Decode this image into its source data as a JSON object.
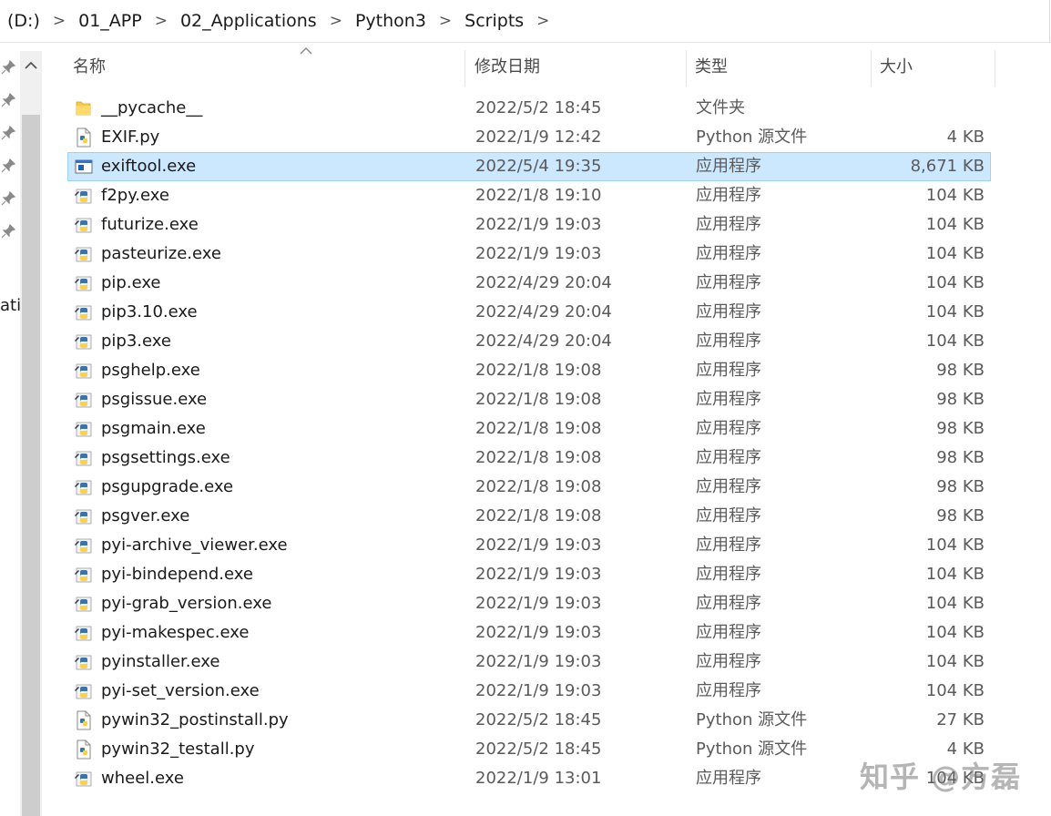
{
  "breadcrumb": {
    "items": [
      "(D:)",
      "01_APP",
      "02_Applications",
      "Python3",
      "Scripts"
    ],
    "separator": ">"
  },
  "nav": {
    "partial_label": "ati"
  },
  "header": {
    "sort_indicator": "^",
    "columns": {
      "name": "名称",
      "date": "修改日期",
      "type": "类型",
      "size": "大小"
    }
  },
  "files": [
    {
      "name": "__pycache__",
      "date": "2022/5/2 18:45",
      "type": "文件夹",
      "size": "",
      "icon": "folder-icon",
      "selected": false
    },
    {
      "name": "EXIF.py",
      "date": "2022/1/9 12:42",
      "type": "Python 源文件",
      "size": "4 KB",
      "icon": "python-file-icon",
      "selected": false
    },
    {
      "name": "exiftool.exe",
      "date": "2022/5/4 19:35",
      "type": "应用程序",
      "size": "8,671 KB",
      "icon": "application-icon",
      "selected": true
    },
    {
      "name": "f2py.exe",
      "date": "2022/1/8 19:10",
      "type": "应用程序",
      "size": "104 KB",
      "icon": "python-exe-icon",
      "selected": false
    },
    {
      "name": "futurize.exe",
      "date": "2022/1/9 19:03",
      "type": "应用程序",
      "size": "104 KB",
      "icon": "python-exe-icon",
      "selected": false
    },
    {
      "name": "pasteurize.exe",
      "date": "2022/1/9 19:03",
      "type": "应用程序",
      "size": "104 KB",
      "icon": "python-exe-icon",
      "selected": false
    },
    {
      "name": "pip.exe",
      "date": "2022/4/29 20:04",
      "type": "应用程序",
      "size": "104 KB",
      "icon": "python-exe-icon",
      "selected": false
    },
    {
      "name": "pip3.10.exe",
      "date": "2022/4/29 20:04",
      "type": "应用程序",
      "size": "104 KB",
      "icon": "python-exe-icon",
      "selected": false
    },
    {
      "name": "pip3.exe",
      "date": "2022/4/29 20:04",
      "type": "应用程序",
      "size": "104 KB",
      "icon": "python-exe-icon",
      "selected": false
    },
    {
      "name": "psghelp.exe",
      "date": "2022/1/8 19:08",
      "type": "应用程序",
      "size": "98 KB",
      "icon": "python-exe-icon",
      "selected": false
    },
    {
      "name": "psgissue.exe",
      "date": "2022/1/8 19:08",
      "type": "应用程序",
      "size": "98 KB",
      "icon": "python-exe-icon",
      "selected": false
    },
    {
      "name": "psgmain.exe",
      "date": "2022/1/8 19:08",
      "type": "应用程序",
      "size": "98 KB",
      "icon": "python-exe-icon",
      "selected": false
    },
    {
      "name": "psgsettings.exe",
      "date": "2022/1/8 19:08",
      "type": "应用程序",
      "size": "98 KB",
      "icon": "python-exe-icon",
      "selected": false
    },
    {
      "name": "psgupgrade.exe",
      "date": "2022/1/8 19:08",
      "type": "应用程序",
      "size": "98 KB",
      "icon": "python-exe-icon",
      "selected": false
    },
    {
      "name": "psgver.exe",
      "date": "2022/1/8 19:08",
      "type": "应用程序",
      "size": "98 KB",
      "icon": "python-exe-icon",
      "selected": false
    },
    {
      "name": "pyi-archive_viewer.exe",
      "date": "2022/1/9 19:03",
      "type": "应用程序",
      "size": "104 KB",
      "icon": "python-exe-icon",
      "selected": false
    },
    {
      "name": "pyi-bindepend.exe",
      "date": "2022/1/9 19:03",
      "type": "应用程序",
      "size": "104 KB",
      "icon": "python-exe-icon",
      "selected": false
    },
    {
      "name": "pyi-grab_version.exe",
      "date": "2022/1/9 19:03",
      "type": "应用程序",
      "size": "104 KB",
      "icon": "python-exe-icon",
      "selected": false
    },
    {
      "name": "pyi-makespec.exe",
      "date": "2022/1/9 19:03",
      "type": "应用程序",
      "size": "104 KB",
      "icon": "python-exe-icon",
      "selected": false
    },
    {
      "name": "pyinstaller.exe",
      "date": "2022/1/9 19:03",
      "type": "应用程序",
      "size": "104 KB",
      "icon": "python-exe-icon",
      "selected": false
    },
    {
      "name": "pyi-set_version.exe",
      "date": "2022/1/9 19:03",
      "type": "应用程序",
      "size": "104 KB",
      "icon": "python-exe-icon",
      "selected": false
    },
    {
      "name": "pywin32_postinstall.py",
      "date": "2022/5/2 18:45",
      "type": "Python 源文件",
      "size": "27 KB",
      "icon": "python-file-icon",
      "selected": false
    },
    {
      "name": "pywin32_testall.py",
      "date": "2022/5/2 18:45",
      "type": "Python 源文件",
      "size": "4 KB",
      "icon": "python-file-icon",
      "selected": false
    },
    {
      "name": "wheel.exe",
      "date": "2022/1/9 13:01",
      "type": "应用程序",
      "size": "104 KB",
      "icon": "python-exe-icon",
      "selected": false
    }
  ],
  "watermark": "知乎 @方磊",
  "colors": {
    "selection_bg": "#cce8ff",
    "selection_border": "#99d1ff",
    "folder": "#f7c948",
    "python_blue": "#3776ab",
    "python_yellow": "#ffd43b"
  }
}
